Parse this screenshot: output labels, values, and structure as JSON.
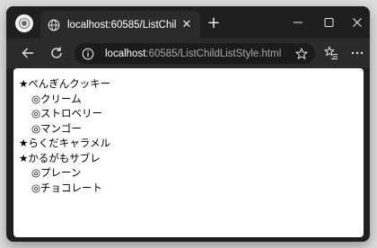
{
  "browser": {
    "tab": {
      "title": "localhost:60585/ListChildListStyle.html"
    },
    "address": {
      "host": "localhost",
      "rest": ":60585/ListChildListStyle.html"
    }
  },
  "page": {
    "outer_marker": "★",
    "inner_marker": "◎",
    "items": [
      {
        "label": "ぺんぎんクッキー",
        "children": [
          "クリーム",
          "ストロベリー",
          "マンゴー"
        ]
      },
      {
        "label": "らくだキャラメル",
        "children": []
      },
      {
        "label": "かるがもサブレ",
        "children": [
          "プレーン",
          "チョコレート"
        ]
      }
    ]
  }
}
